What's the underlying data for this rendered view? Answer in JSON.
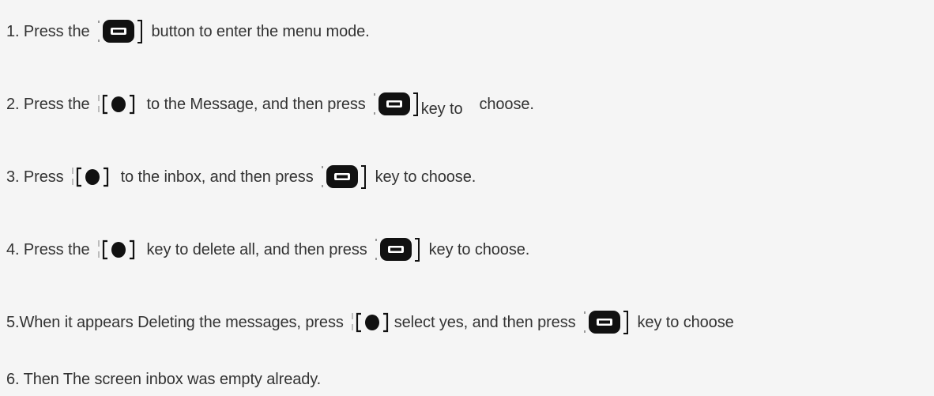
{
  "steps": [
    {
      "a": "1. Press the",
      "b": "button to enter the menu mode."
    },
    {
      "a": "2. Press the",
      "b": "to the Message, and then press",
      "c": "key to",
      "d": "choose."
    },
    {
      "a": "3. Press",
      "b": "to the inbox, and then press",
      "c": "key to choose."
    },
    {
      "a": "4. Press the",
      "b": "key to delete all, and then press",
      "c": "key to choose."
    },
    {
      "a": "5.When it appears Deleting the messages, press",
      "b": "select yes, and then press",
      "c": "key to choose"
    },
    {
      "a": "6. Then The screen inbox was empty already."
    }
  ],
  "icons": {
    "menu_key": "menu-key-icon",
    "nav_key": "navigation-key-icon"
  },
  "colors": {
    "text": "#333333",
    "background": "#f5f5f5",
    "key_fill": "#111111"
  }
}
